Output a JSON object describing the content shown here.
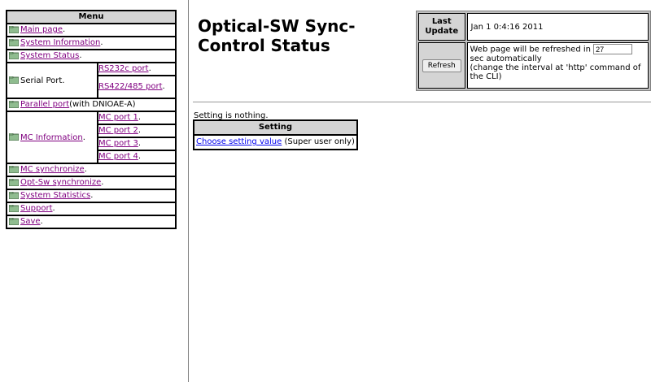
{
  "menu": {
    "header": "Menu",
    "items": {
      "main_page": "Main page",
      "system_information": "System Information",
      "system_status": "System Status"
    },
    "serial": {
      "label": "Serial Port.",
      "links": [
        "RS232c port",
        "RS422/485 port"
      ]
    },
    "parallel": {
      "link": "Parallel port",
      "suffix": "(with DNIOAE-A)"
    },
    "mc": {
      "label": "MC Information",
      "links": [
        "MC port 1",
        "MC port 2",
        "MC port 3",
        "MC port 4"
      ]
    },
    "bottom_items": {
      "mc_sync": "MC synchronize",
      "opt_sw_sync": "Opt-Sw synchronize",
      "system_statistics": "System Statistics",
      "support": "Support",
      "save": "Save"
    }
  },
  "page": {
    "title": "Optical-SW Sync-Control Status"
  },
  "update_box": {
    "last_update_label": "Last Update",
    "last_update_value": "Jan 1 0:4:16 2011",
    "refresh_label": "Refresh",
    "refresh_text_before": "Web page will be refreshed in",
    "refresh_seconds": "27",
    "refresh_text_after": "sec automatically",
    "refresh_note": "(change the interval at 'http' command of the CLI)"
  },
  "setting": {
    "status_text": "Setting is nothing.",
    "header": "Setting",
    "link": "Choose setting value",
    "note": "(Super user only)"
  },
  "colors": {
    "header_bg": "#d4d4d4",
    "visited_link": "#800080",
    "link": "#0000ee",
    "folder_icon": "#8fbc8f"
  }
}
